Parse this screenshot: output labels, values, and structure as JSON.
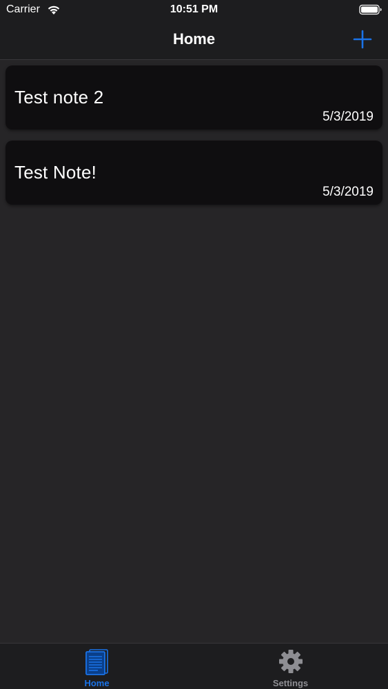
{
  "status_bar": {
    "carrier": "Carrier",
    "time": "10:51 PM",
    "wifi_icon": "wifi-icon",
    "battery_icon": "battery-icon"
  },
  "nav_bar": {
    "title": "Home",
    "add_icon": "plus-icon"
  },
  "notes": [
    {
      "title": "Test note 2",
      "date": "5/3/2019"
    },
    {
      "title": "Test Note!",
      "date": "5/3/2019"
    }
  ],
  "tab_bar": {
    "tabs": [
      {
        "label": "Home",
        "icon": "notes-icon",
        "selected": true
      },
      {
        "label": "Settings",
        "icon": "gear-icon",
        "selected": false
      }
    ]
  },
  "colors": {
    "accent": "#1a73e8",
    "background": "#262527",
    "bar": "#1d1d1f",
    "card": "#0f0e10",
    "inactive_tab": "#8e8e93"
  }
}
